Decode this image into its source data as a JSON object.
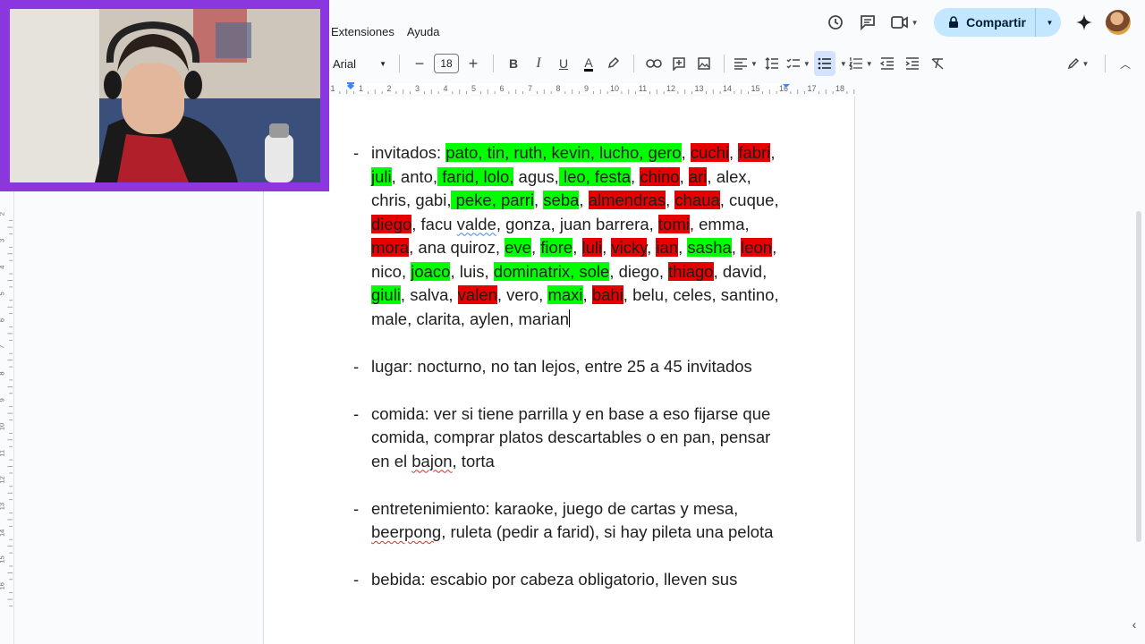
{
  "menu": [
    "Extensiones",
    "Ayuda"
  ],
  "header": {
    "share_label": "Compartir"
  },
  "toolbar": {
    "font": "Arial",
    "font_size": "18"
  },
  "ruler": {
    "labels": [
      "1",
      "1",
      "2",
      "3",
      "4",
      "5",
      "6",
      "7",
      "8",
      "9",
      "10",
      "11",
      "12",
      "13",
      "14",
      "15",
      "16",
      "17",
      "18"
    ]
  },
  "vruler": {
    "labels": [
      "2",
      "3",
      "4",
      "5",
      "6",
      "7",
      "8",
      "9",
      "10",
      "11",
      "12",
      "13",
      "14",
      "15",
      "16"
    ]
  },
  "highlight_colors": {
    "green": "#00ff00",
    "red": "#e60000",
    "accent": "#c2e7ff",
    "webcam_border": "#8a37e0"
  },
  "document": {
    "items": [
      {
        "segments": [
          {
            "t": "invitados: "
          },
          {
            "t": "pato, tin, ruth, kevin, lucho, gero",
            "h": "g"
          },
          {
            "t": ", "
          },
          {
            "t": "cuchi",
            "h": "r"
          },
          {
            "t": ", "
          },
          {
            "t": "fabri",
            "h": "r"
          },
          {
            "t": ", "
          },
          {
            "t": "juli",
            "h": "g"
          },
          {
            "t": ", anto,"
          },
          {
            "t": " farid, lolo,",
            "h": "g"
          },
          {
            "t": " agus,"
          },
          {
            "t": " leo, festa",
            "h": "g"
          },
          {
            "t": ", "
          },
          {
            "t": "chino",
            "h": "r"
          },
          {
            "t": ", "
          },
          {
            "t": "ari",
            "h": "r"
          },
          {
            "t": ", "
          },
          {
            "t": "alex, chris, gabi,"
          },
          {
            "t": " peke, parri",
            "h": "g"
          },
          {
            "t": ", "
          },
          {
            "t": "seba",
            "h": "g"
          },
          {
            "t": ", "
          },
          {
            "t": "almendras",
            "h": "r"
          },
          {
            "t": ", "
          },
          {
            "t": "chaua",
            "h": "r"
          },
          {
            "t": ", cuque, "
          },
          {
            "t": "diego",
            "h": "r"
          },
          {
            "t": ", facu "
          },
          {
            "t": "valde",
            "s": "b"
          },
          {
            "t": ", gonza, juan "
          },
          {
            "t": "barrera, "
          },
          {
            "t": "tomi",
            "h": "r"
          },
          {
            "t": ", emma, "
          },
          {
            "t": "mora",
            "h": "r"
          },
          {
            "t": ", ana quiroz, "
          },
          {
            "t": "eve",
            "h": "g"
          },
          {
            "t": ", "
          },
          {
            "t": "fiore",
            "h": "g"
          },
          {
            "t": ", "
          },
          {
            "t": "luli",
            "h": "r"
          },
          {
            "t": ", "
          },
          {
            "t": "vicky",
            "h": "r"
          },
          {
            "t": ", "
          },
          {
            "t": "ian",
            "h": "r"
          },
          {
            "t": ", "
          },
          {
            "t": "sasha",
            "h": "g"
          },
          {
            "t": ", "
          },
          {
            "t": "leon",
            "h": "r"
          },
          {
            "t": ", nico, "
          },
          {
            "t": "joaco",
            "h": "g"
          },
          {
            "t": ", luis, "
          },
          {
            "t": "dominatrix, sole",
            "h": "g"
          },
          {
            "t": ", diego, "
          },
          {
            "t": "thiago",
            "h": "r"
          },
          {
            "t": ", david, "
          },
          {
            "t": "giuli",
            "h": "g"
          },
          {
            "t": ", salva, "
          },
          {
            "t": "valen",
            "h": "r"
          },
          {
            "t": ", vero, "
          },
          {
            "t": "maxi",
            "h": "g"
          },
          {
            "t": ", "
          },
          {
            "t": "bahi",
            "h": "r"
          },
          {
            "t": ", belu, celes, santino, male, "
          },
          {
            "t": "clarita, aylen, marian"
          }
        ],
        "cursor": true
      },
      {
        "segments": [
          {
            "t": "lugar: nocturno, no tan lejos, entre 25 a 45 invitados"
          }
        ]
      },
      {
        "segments": [
          {
            "t": "comida: ver si tiene parrilla y en base a eso fijarse que comida, comprar platos descartables o en pan, pensar en el "
          },
          {
            "t": "bajon",
            "s": "r"
          },
          {
            "t": ", torta"
          }
        ]
      },
      {
        "segments": [
          {
            "t": "entretenimiento: karaoke, juego de cartas y mesa, "
          },
          {
            "t": "beerpong",
            "s": "r"
          },
          {
            "t": ", ruleta (pedir a farid), si hay pileta una pelota"
          }
        ]
      },
      {
        "segments": [
          {
            "t": "bebida: escabio por cabeza obligatorio, lleven sus"
          }
        ]
      }
    ]
  }
}
